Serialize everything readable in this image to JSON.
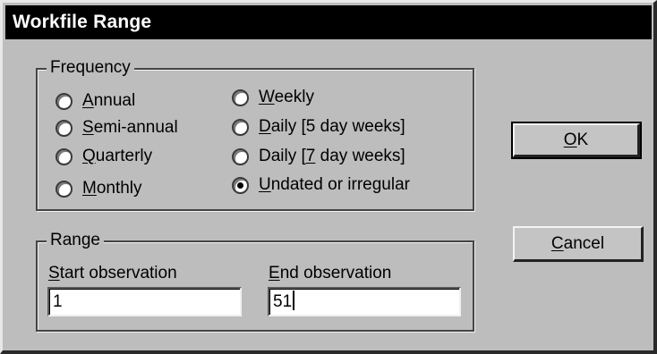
{
  "dialog": {
    "title": "Workfile Range"
  },
  "frequency": {
    "legend": "Frequency",
    "options": [
      {
        "pre": "",
        "u": "A",
        "post": "nnual",
        "selected": false
      },
      {
        "pre": "",
        "u": "S",
        "post": "emi-annual",
        "selected": false
      },
      {
        "pre": "",
        "u": "Q",
        "post": "uarterly",
        "selected": false
      },
      {
        "pre": "",
        "u": "M",
        "post": "onthly",
        "selected": false
      },
      {
        "pre": "",
        "u": "W",
        "post": "eekly",
        "selected": false
      },
      {
        "pre": "",
        "u": "D",
        "post": "aily [5 day weeks]",
        "selected": false
      },
      {
        "pre": "Daily [",
        "u": "7",
        "post": " day weeks]",
        "selected": false
      },
      {
        "pre": "",
        "u": "U",
        "post": "ndated or irregular",
        "selected": true
      }
    ]
  },
  "range": {
    "legend": "Range",
    "start": {
      "pre": "",
      "u": "S",
      "post": "tart observation",
      "value": "1"
    },
    "end": {
      "pre": "",
      "u": "E",
      "post": "nd observation",
      "value": "51"
    }
  },
  "buttons": {
    "ok": {
      "u": "O",
      "post": "K"
    },
    "cancel": {
      "u": "C",
      "post": "ancel"
    }
  }
}
